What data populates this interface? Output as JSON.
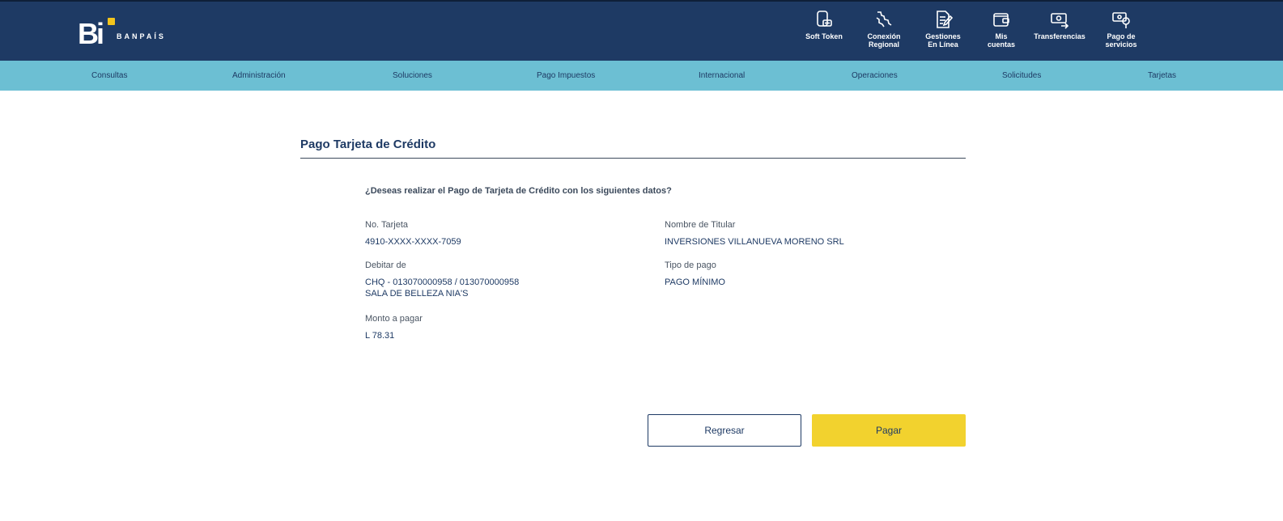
{
  "brand": {
    "logo_letters": "Bi",
    "name": "BANPAÍS",
    "accent_color": "#f2c41c"
  },
  "colors": {
    "header_bg": "#1e3a64",
    "nav_bg": "#6cbfd3",
    "pay_button": "#f2d22e"
  },
  "top_actions": [
    {
      "label": "Soft Token",
      "icon": "soft-token-icon"
    },
    {
      "label": "Conexión\nRegional",
      "icon": "regional-connection-icon"
    },
    {
      "label": "Gestiones\nEn Línea",
      "icon": "online-forms-icon"
    },
    {
      "label": "Mis\ncuentas",
      "icon": "wallet-icon"
    },
    {
      "label": "Transferencias",
      "icon": "transfer-icon"
    },
    {
      "label": "Pago de\nservicios",
      "icon": "service-payment-icon"
    }
  ],
  "nav": [
    {
      "label": "Consultas"
    },
    {
      "label": "Administración"
    },
    {
      "label": "Soluciones"
    },
    {
      "label": "Pago Impuestos"
    },
    {
      "label": "Internacional"
    },
    {
      "label": "Operaciones"
    },
    {
      "label": "Solicitudes"
    },
    {
      "label": "Tarjetas"
    }
  ],
  "page": {
    "title": "Pago Tarjeta de Crédito",
    "question": "¿Deseas realizar el Pago de Tarjeta de Crédito con los siguientes datos?"
  },
  "fields": {
    "card": {
      "label": "No. Tarjeta",
      "value": "4910-XXXX-XXXX-7059"
    },
    "holder": {
      "label": "Nombre de Titular",
      "value": "INVERSIONES VILLANUEVA MORENO SRL"
    },
    "debit": {
      "label": "Debitar de",
      "value_line1": "CHQ - 013070000958 / 013070000958",
      "value_line2": "SALA DE BELLEZA NIA'S"
    },
    "payment_type": {
      "label": "Tipo de pago",
      "value": "PAGO MÍNIMO"
    },
    "amount": {
      "label": "Monto a pagar",
      "value": "L 78.31"
    }
  },
  "buttons": {
    "back": "Regresar",
    "pay": "Pagar"
  }
}
